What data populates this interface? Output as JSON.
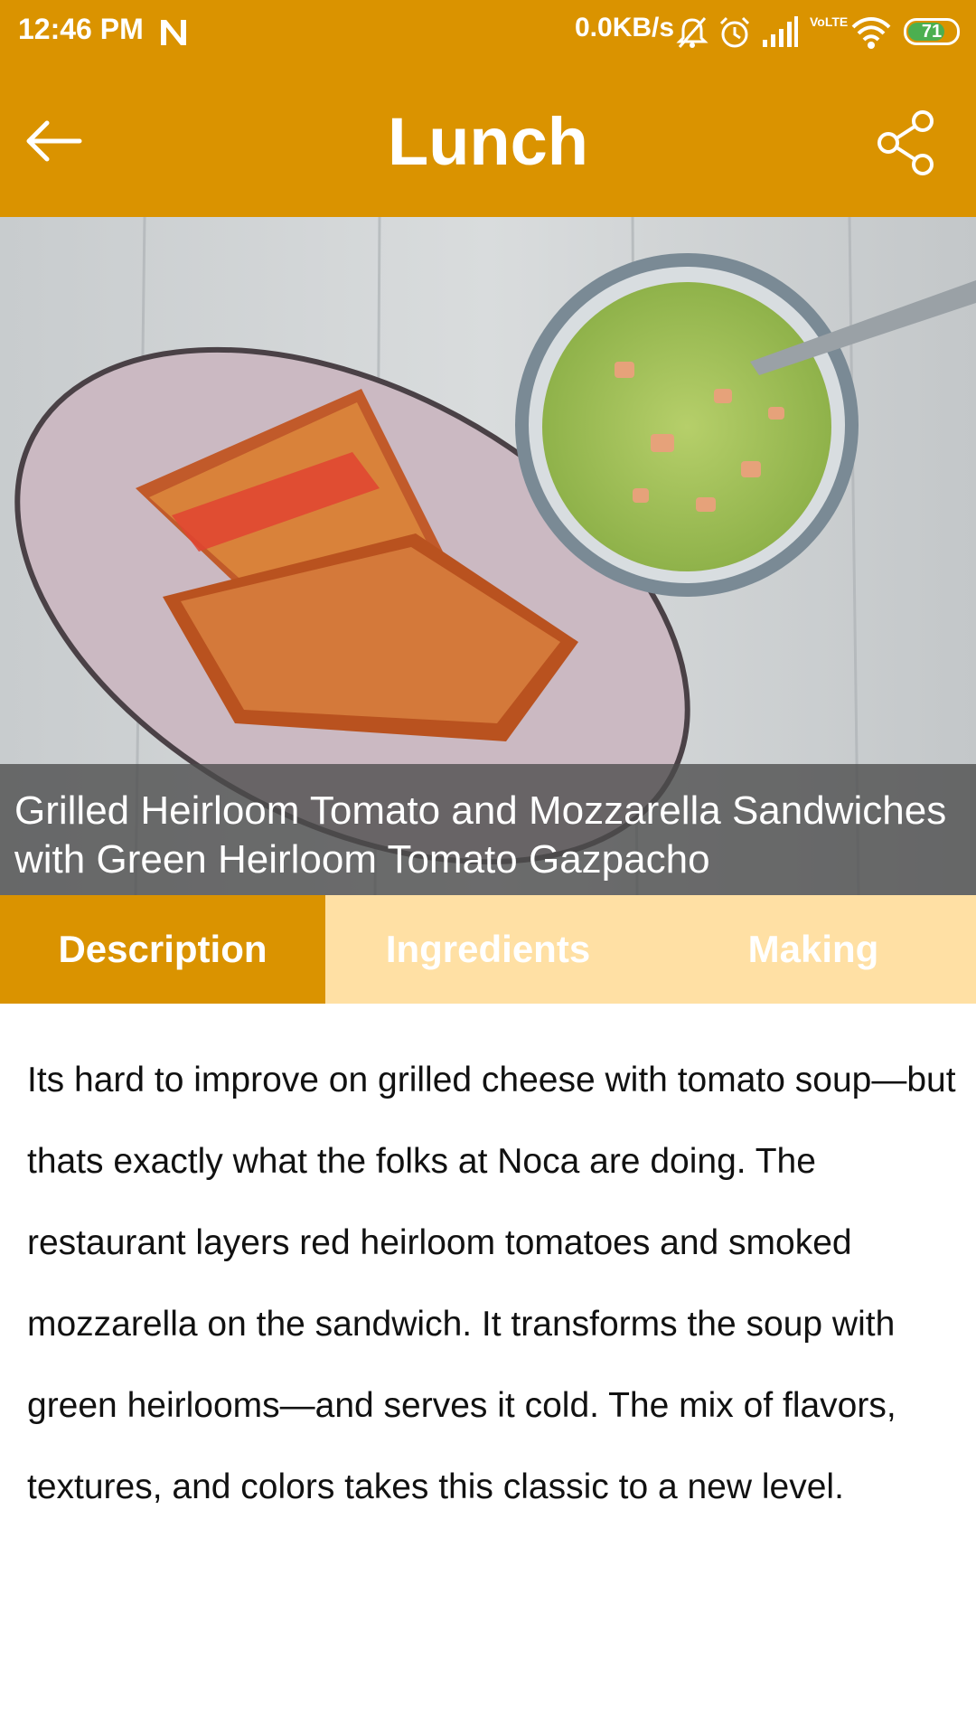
{
  "status_bar": {
    "time": "12:46 PM",
    "network_speed": "0.0KB/s",
    "network_label": "VoLTE",
    "battery_level": "71",
    "icons": [
      "notification-n-icon",
      "mute-bell-icon",
      "alarm-icon",
      "signal-icon",
      "volte-icon",
      "wifi-icon",
      "battery-icon"
    ]
  },
  "app_bar": {
    "title": "Lunch",
    "back_icon": "arrow-left-icon",
    "share_icon": "share-icon"
  },
  "hero": {
    "image_description": "grilled sandwich on plate with green gazpacho bowl",
    "caption": "Grilled Heirloom Tomato and Mozzarella Sandwiches with Green Heirloom Tomato Gazpacho"
  },
  "tabs": [
    {
      "label": "Description",
      "active": true
    },
    {
      "label": "Ingredients",
      "active": false
    },
    {
      "label": "Making",
      "active": false
    }
  ],
  "description": "Its hard to improve on grilled cheese with tomato soup—but thats exactly what the folks at Noca are doing. The restaurant layers red heirloom tomatoes and smoked mozzarella on the sandwich. It transforms the soup with green heirlooms—and serves it cold. The mix of flavors, textures, and colors takes this classic to a new level.",
  "colors": {
    "primary": "#DA9300",
    "tab_inactive": "#FFE0A4",
    "caption_overlay": "#4B4B4B"
  }
}
